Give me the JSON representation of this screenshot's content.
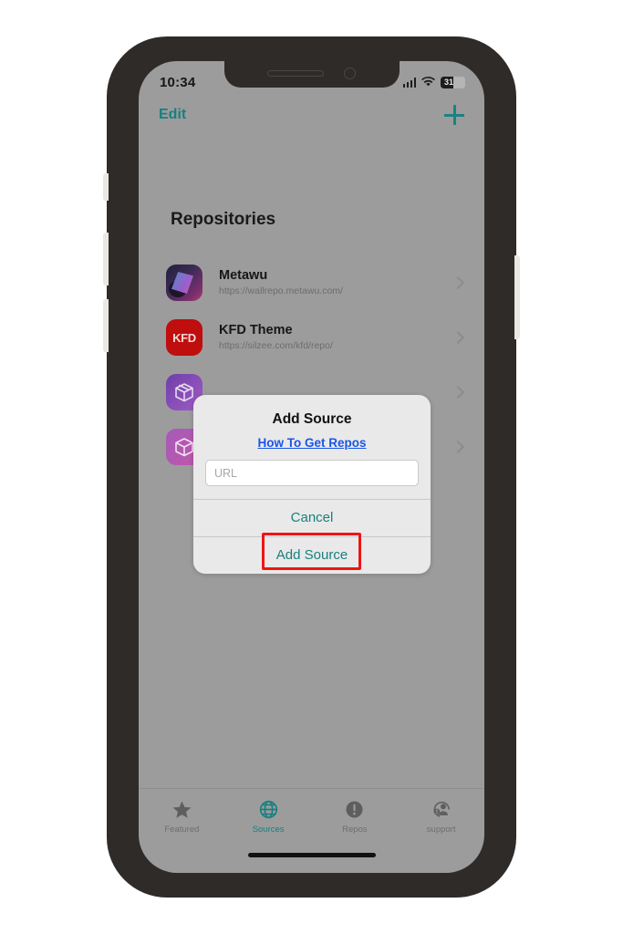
{
  "status_bar": {
    "time": "10:34",
    "signal_icon": "cellular-signal-icon",
    "wifi_icon": "wifi-icon",
    "battery_icon": "battery-icon",
    "battery_level": "31"
  },
  "nav": {
    "edit_label": "Edit",
    "add_icon": "plus-icon"
  },
  "page": {
    "title": "Repositories"
  },
  "repositories": [
    {
      "name": "Metawu",
      "url": "https://wallrepo.metawu.com/",
      "icon": "metawu-app-icon",
      "chevron": "chevron-right-icon"
    },
    {
      "name": "KFD Theme",
      "url": "https://silzee.com/kfd/repo/",
      "icon": "kfd-app-icon",
      "icon_text": "KFD",
      "chevron": "chevron-right-icon"
    },
    {
      "name": "",
      "url": "",
      "icon": "package-app-icon",
      "chevron": "chevron-right-icon"
    },
    {
      "name": "",
      "url": "",
      "icon": "package-app-icon",
      "chevron": "chevron-right-icon"
    }
  ],
  "dialog": {
    "title": "Add Source",
    "link_label": "How To Get Repos",
    "url_placeholder": "URL",
    "url_value": "",
    "cancel_label": "Cancel",
    "confirm_label": "Add Source",
    "highlight_color": "#f01414",
    "accent_color": "#18807e",
    "link_color": "#1a56e8"
  },
  "tab_bar": {
    "tabs": [
      {
        "label": "Featured",
        "icon": "star-icon",
        "active": false
      },
      {
        "label": "Sources",
        "icon": "globe-icon",
        "active": true
      },
      {
        "label": "Repos",
        "icon": "exclamation-icon",
        "active": false
      },
      {
        "label": "support",
        "icon": "person-info-icon",
        "active": false
      }
    ]
  }
}
